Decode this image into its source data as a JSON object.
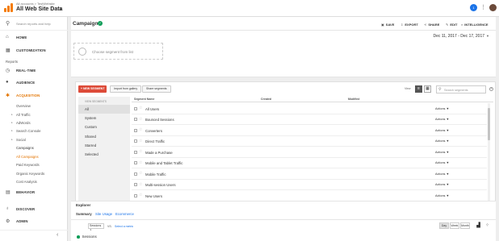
{
  "topbar": {
    "breadcrumb": "All accounts > TestWebsite",
    "account": "All Web Site Data",
    "notification_count": "1"
  },
  "sidebar": {
    "search_placeholder": "Search reports and help",
    "home": "HOME",
    "customization": "CUSTOMIZATION",
    "reports_heading": "Reports",
    "realtime": "REAL-TIME",
    "audience": "AUDIENCE",
    "acquisition": "ACQUISITION",
    "acq_items": {
      "overview": "Overview",
      "all_traffic": "All Traffic",
      "adwords": "AdWords",
      "search_console": "Search Console",
      "social": "Social",
      "campaigns": "Campaigns",
      "all_campaigns": "All Campaigns",
      "paid_keywords": "Paid Keywords",
      "organic_keywords": "Organic Keywords",
      "cost_analysis": "Cost Analysis"
    },
    "behavior": "BEHAVIOR",
    "discover": "DISCOVER",
    "admin": "ADMIN",
    "collapse_icon": "chevron-left-icon"
  },
  "header": {
    "title": "Campaigns",
    "actions": {
      "save": "SAVE",
      "export": "EXPORT",
      "share": "SHARE",
      "edit": "EDIT",
      "intelligence": "INTELLIGENCE"
    }
  },
  "segment_panel": {
    "choose_placeholder": "Choose segment from list",
    "date_range": "Dec 11, 2017 - Dec 17, 2017",
    "date_caret": "▼"
  },
  "builder": {
    "new_segment": "+ NEW SEGMENT",
    "import_gallery": "Import from gallery",
    "share_segments": "Share segments",
    "view_label": "View",
    "search_placeholder": "Search segments",
    "views_heading": "VIEW SEGMENTS",
    "views": [
      "All",
      "System",
      "Custom",
      "Shared",
      "Starred",
      "Selected"
    ],
    "columns": {
      "name": "Segment Name",
      "created": "Created",
      "modified": "Modified"
    },
    "segments": [
      "All Users",
      "Bounced Sessions",
      "Converters",
      "Direct Traffic",
      "Made a Purchase",
      "Mobile and Tablet Traffic",
      "Mobile Traffic",
      "Multi-session Users",
      "New Users"
    ],
    "row_action": "Actions ▼",
    "apply": "Apply",
    "cancel": "Cancel"
  },
  "explorer": {
    "title": "Explorer",
    "tabs": [
      "Summary",
      "Site Usage",
      "Ecommerce"
    ],
    "metric": "Sessions",
    "metric_caret": "▼",
    "vs": "VS.",
    "select_metric": "Select a metric",
    "periods": [
      "Day",
      "Week",
      "Month"
    ],
    "series_name": "Sessions"
  }
}
